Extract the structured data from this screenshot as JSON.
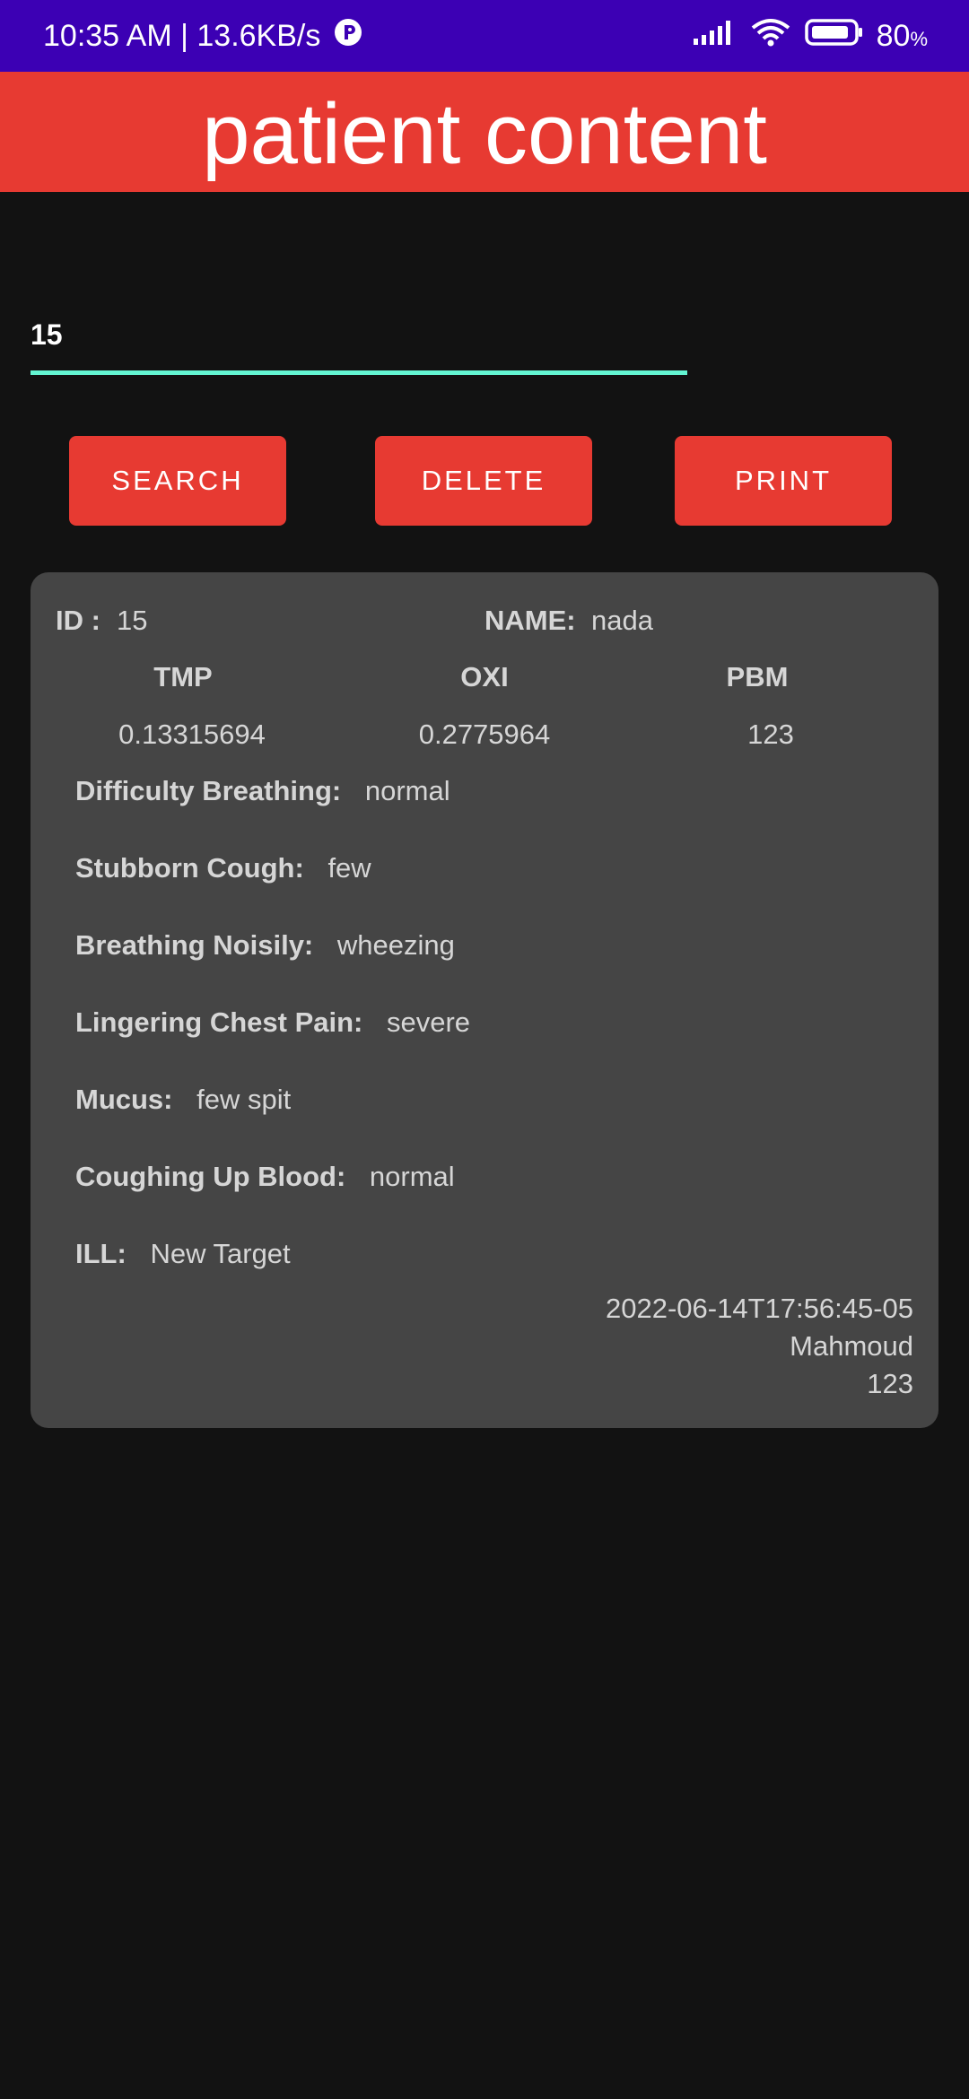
{
  "status_bar": {
    "time_speed": "10:35 AM | 13.6KB/s",
    "battery": "80",
    "battery_unit": "%"
  },
  "app_bar": {
    "title": "patient content"
  },
  "search": {
    "value": "15"
  },
  "buttons": {
    "search": "SEARCH",
    "delete": "DELETE",
    "print": "PRINT"
  },
  "patient": {
    "id_label": "ID :",
    "id_value": "15",
    "name_label": "NAME:",
    "name_value": "nada",
    "vitals_headers": [
      "TMP",
      "OXI",
      "PBM"
    ],
    "vitals_values": [
      "0.13315694",
      "0.2775964",
      "123"
    ],
    "fields": [
      {
        "label": "Difficulty Breathing:",
        "value": "normal"
      },
      {
        "label": "Stubborn Cough:",
        "value": "few"
      },
      {
        "label": "Breathing Noisily:",
        "value": "wheezing"
      },
      {
        "label": "Lingering Chest Pain:",
        "value": "severe"
      },
      {
        "label": "Mucus:",
        "value": "few spit"
      },
      {
        "label": "Coughing Up Blood:",
        "value": "normal"
      },
      {
        "label": "ILL:",
        "value": "New Target"
      }
    ],
    "timestamp": "2022-06-14T17:56:45-05",
    "doctor": "Mahmoud",
    "code": "123"
  }
}
